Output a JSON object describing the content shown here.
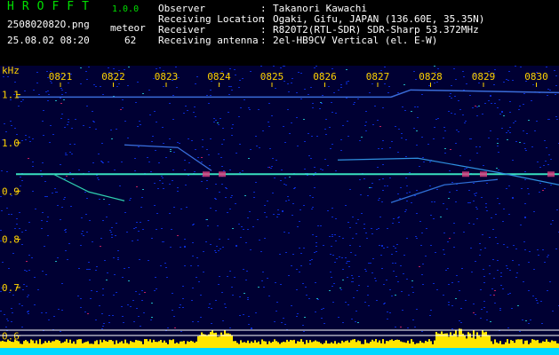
{
  "header": {
    "app_name": "HROFFT",
    "version": "1.0.0",
    "filename": "250802082O.png",
    "meteor_label": "meteor",
    "meteor_count": "62",
    "datetime": "25.08.02 08:20",
    "info": [
      {
        "label": "Observer",
        "value": "Takanori Kawachi"
      },
      {
        "label": "Receiving Location",
        "value": "Ogaki, Gifu, JAPAN (136.60E, 35.35N)"
      },
      {
        "label": "Receiver",
        "value": "R820T2(RTL-SDR) SDR-Sharp 53.372MHz"
      },
      {
        "label": "Receiving antenna",
        "value": "2el-HB9CV Vertical (el. E-W)"
      }
    ]
  },
  "spectrogram": {
    "y_unit": "kHz",
    "y_ticks": [
      "1.1",
      "1.0",
      "0.9",
      "0.8",
      "0.7",
      "0.6"
    ],
    "y_range": [
      0.56,
      1.16
    ],
    "x_ticks": [
      "0821",
      "0822",
      "0823",
      "0824",
      "0825",
      "0826",
      "0827",
      "0828",
      "0829",
      "0830"
    ],
    "carrier_khz": 0.935,
    "upper_line_khz": 1.095,
    "colors": {
      "background": "#000033",
      "noise": "#0a2ad0",
      "signal": "#39e0c0",
      "axis_text": "#ffd200",
      "level_bar": "#ffe600",
      "base_bar": "#00d8ff"
    }
  }
}
